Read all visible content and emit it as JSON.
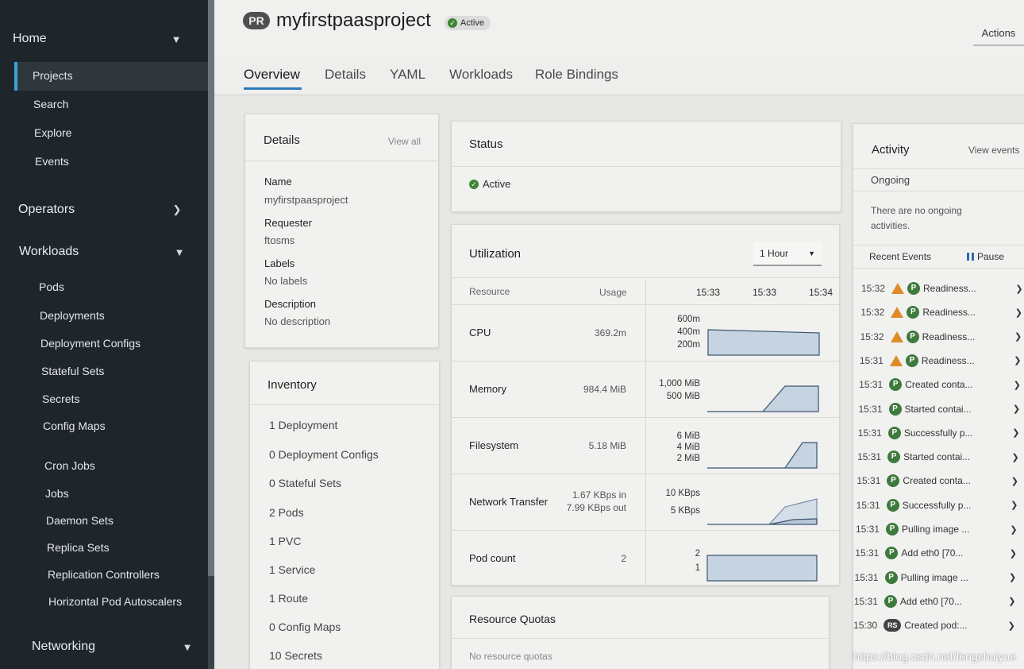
{
  "sidebar": {
    "sections": {
      "home": "Home",
      "operators": "Operators",
      "workloads": "Workloads",
      "networking": "Networking"
    },
    "home_items": [
      "Projects",
      "Search",
      "Explore",
      "Events"
    ],
    "workload_items": [
      "Pods",
      "Deployments",
      "Deployment Configs",
      "Stateful Sets",
      "Secrets",
      "Config Maps",
      "Cron Jobs",
      "Jobs",
      "Daemon Sets",
      "Replica Sets",
      "Replication Controllers",
      "Horizontal Pod Autoscalers"
    ]
  },
  "header": {
    "badge": "PR",
    "title": "myfirstpaasproject",
    "status": "Active",
    "actions": "Actions"
  },
  "tabs": [
    "Overview",
    "Details",
    "YAML",
    "Workloads",
    "Role Bindings"
  ],
  "details": {
    "title": "Details",
    "view_all": "View all",
    "name_label": "Name",
    "name_value": "myfirstpaasproject",
    "requester_label": "Requester",
    "requester_value": "ftosms",
    "labels_label": "Labels",
    "labels_value": "No labels",
    "description_label": "Description",
    "description_value": "No description"
  },
  "inventory": {
    "title": "Inventory",
    "items": [
      "1 Deployment",
      "0 Deployment Configs",
      "0 Stateful Sets",
      "2 Pods",
      "1 PVC",
      "1 Service",
      "1 Route",
      "0 Config Maps",
      "10 Secrets"
    ]
  },
  "status": {
    "title": "Status",
    "value": "Active"
  },
  "utilization": {
    "title": "Utilization",
    "range": "1 Hour",
    "col_resource": "Resource",
    "col_usage": "Usage",
    "times": [
      "15:33",
      "15:33",
      "15:34"
    ],
    "rows": [
      {
        "name": "CPU",
        "usage": "369.2m",
        "axis": [
          "600m",
          "400m",
          "200m"
        ]
      },
      {
        "name": "Memory",
        "usage": "984.4 MiB",
        "axis": [
          "1,000 MiB",
          "500 MiB"
        ]
      },
      {
        "name": "Filesystem",
        "usage": "5.18 MiB",
        "axis": [
          "6 MiB",
          "4 MiB",
          "2 MiB"
        ]
      },
      {
        "name": "Network Transfer",
        "usage_in": "1.67 KBps in",
        "usage_out": "7.99 KBps out",
        "axis": [
          "10 KBps",
          "5 KBps"
        ]
      },
      {
        "name": "Pod count",
        "usage": "2",
        "axis": [
          "2",
          "1"
        ]
      }
    ]
  },
  "quotas": {
    "title": "Resource Quotas",
    "empty": "No resource quotas"
  },
  "activity": {
    "title": "Activity",
    "view_events": "View events",
    "ongoing": "Ongoing",
    "ongoing_empty": "There are no ongoing activities.",
    "recent": "Recent Events",
    "pause": "Pause",
    "events": [
      {
        "time": "15:32",
        "warn": true,
        "badge": "P",
        "text": "Readiness..."
      },
      {
        "time": "15:32",
        "warn": true,
        "badge": "P",
        "text": "Readiness..."
      },
      {
        "time": "15:32",
        "warn": true,
        "badge": "P",
        "text": "Readiness..."
      },
      {
        "time": "15:31",
        "warn": true,
        "badge": "P",
        "text": "Readiness..."
      },
      {
        "time": "15:31",
        "warn": false,
        "badge": "P",
        "text": "Created conta..."
      },
      {
        "time": "15:31",
        "warn": false,
        "badge": "P",
        "text": "Started contai..."
      },
      {
        "time": "15:31",
        "warn": false,
        "badge": "P",
        "text": "Successfully p..."
      },
      {
        "time": "15:31",
        "warn": false,
        "badge": "P",
        "text": "Started contai..."
      },
      {
        "time": "15:31",
        "warn": false,
        "badge": "P",
        "text": "Created conta..."
      },
      {
        "time": "15:31",
        "warn": false,
        "badge": "P",
        "text": "Successfully p..."
      },
      {
        "time": "15:31",
        "warn": false,
        "badge": "P",
        "text": "Pulling image ..."
      },
      {
        "time": "15:31",
        "warn": false,
        "badge": "P",
        "text": "Add eth0 [70..."
      },
      {
        "time": "15:31",
        "warn": false,
        "badge": "P",
        "text": "Pulling image ..."
      },
      {
        "time": "15:31",
        "warn": false,
        "badge": "P",
        "text": "Add eth0 [70..."
      },
      {
        "time": "15:30",
        "warn": false,
        "badge": "RS",
        "text": "Created pod:..."
      }
    ]
  },
  "watermark": "https://blog.csdn.net/fengshuiyue"
}
